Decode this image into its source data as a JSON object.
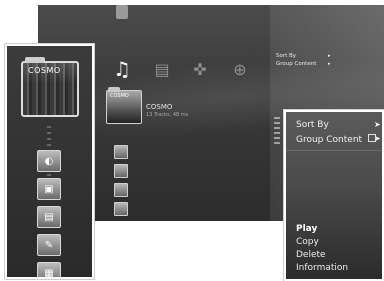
{
  "background": {
    "categories": [
      {
        "name": "music",
        "icon": "♫",
        "active": true
      },
      {
        "name": "video",
        "icon": "▤"
      },
      {
        "name": "game",
        "icon": "✜"
      },
      {
        "name": "network",
        "icon": "⊕"
      }
    ],
    "selected_item": {
      "title": "COSMO",
      "thumb_label": "COSMO",
      "subtitle": "13 Tracks, 48 ms"
    },
    "options": {
      "sort_by": "Sort By",
      "group_content": "Group Content"
    }
  },
  "left_zoom": {
    "thumb_label": "COSMO",
    "icons": [
      "◐",
      "▣",
      "▤",
      "✎",
      "▦"
    ]
  },
  "right_zoom": {
    "sort_by": "Sort By",
    "group_content": "Group Content",
    "arrow": "➤",
    "items": [
      "Play",
      "Copy",
      "Delete",
      "Information"
    ],
    "active_item": "Play"
  },
  "colors": {
    "accent": "#ffffff",
    "bg_dark": "#2c2c2c"
  }
}
